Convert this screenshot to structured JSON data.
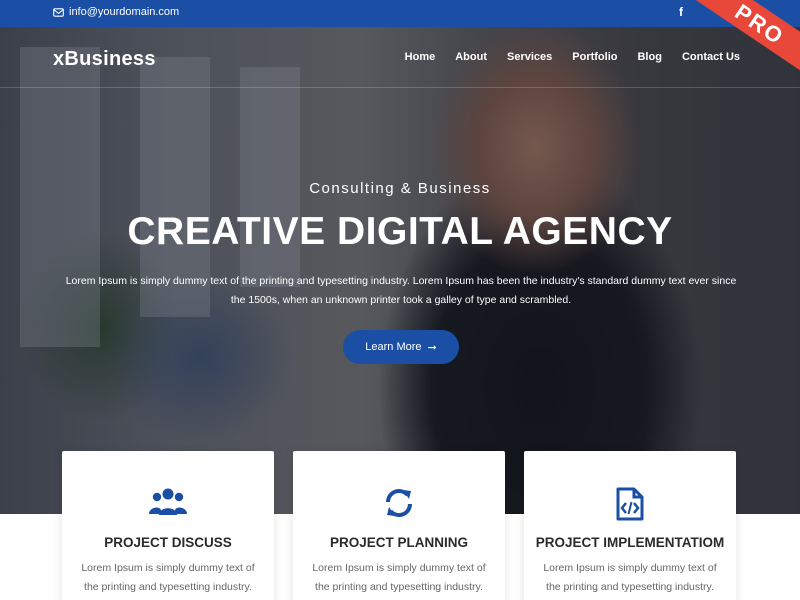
{
  "topbar": {
    "email": "info@yourdomain.com",
    "facebook_icon": "f"
  },
  "header": {
    "logo": "xBusiness",
    "nav": [
      "Home",
      "About",
      "Services",
      "Portfolio",
      "Blog",
      "Contact Us"
    ],
    "ribbon": "PRO"
  },
  "hero": {
    "subtitle": "Consulting & Business",
    "headline": "CREATIVE DIGITAL AGENCY",
    "description": "Lorem Ipsum is simply dummy text of the printing and typesetting industry. Lorem Ipsum has been the industry's standard dummy text ever since the 1500s, when an unknown printer took a galley of type and scrambled.",
    "button_label": "Learn More"
  },
  "cards": [
    {
      "icon": "users-icon",
      "title": "PROJECT DISCUSS",
      "text": "Lorem Ipsum is simply dummy text of the printing and typesetting industry."
    },
    {
      "icon": "sync-icon",
      "title": "PROJECT PLANNING",
      "text": "Lorem Ipsum is simply dummy text of the printing and typesetting industry."
    },
    {
      "icon": "code-file-icon",
      "title": "PROJECT IMPLEMENTATIOM",
      "text": "Lorem Ipsum is simply dummy text of the printing and typesetting industry."
    }
  ],
  "colors": {
    "primary": "#1a4fa5",
    "ribbon": "#e8483a"
  }
}
